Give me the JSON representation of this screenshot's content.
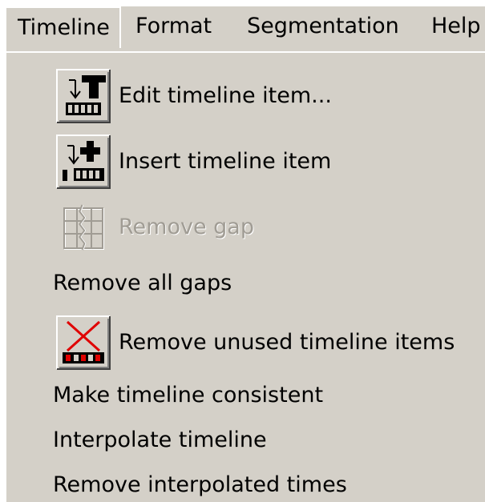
{
  "menubar": {
    "items": [
      {
        "label": "Timeline"
      },
      {
        "label": "Format"
      },
      {
        "label": "Segmentation"
      },
      {
        "label": "Help"
      }
    ]
  },
  "menu": {
    "items": [
      {
        "label": "Edit timeline item...",
        "icon": "edit-timeline-item-icon",
        "enabled": true
      },
      {
        "label": "Insert timeline item",
        "icon": "insert-timeline-item-icon",
        "enabled": true
      },
      {
        "label": "Remove gap",
        "icon": "remove-gap-icon",
        "enabled": false
      },
      {
        "label": "Remove all gaps",
        "enabled": true
      },
      {
        "label": "Remove unused timeline items",
        "icon": "remove-unused-items-icon",
        "enabled": true
      },
      {
        "label": "Make timeline consistent",
        "enabled": true
      },
      {
        "label": "Interpolate timeline",
        "enabled": true
      },
      {
        "label": "Remove interpolated times",
        "enabled": true
      }
    ]
  },
  "colors": {
    "menu_bg": "#d4d0c8",
    "highlight": "#ffffff",
    "disabled_text": "#a09c94",
    "delete_red": "#e00000"
  }
}
